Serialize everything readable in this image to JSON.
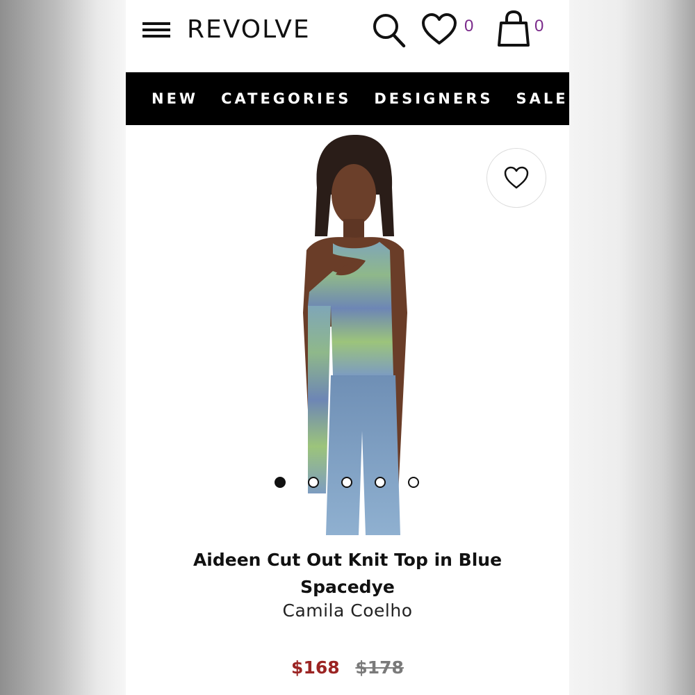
{
  "header": {
    "logo": "REVOLVE",
    "wishlist_count": "0",
    "bag_count": "0"
  },
  "nav": {
    "items": [
      "NEW",
      "CATEGORIES",
      "DESIGNERS",
      "SALE"
    ]
  },
  "product": {
    "title_line1": "Aideen Cut Out Knit Top in Blue",
    "title_line2": "Spacedye",
    "brand": "Camila Coelho",
    "sale_price": "$168",
    "original_price": "$178",
    "image_count": 5,
    "active_image": 1
  },
  "colors": {
    "sale_price": "#9b2423",
    "count_badge": "#7b2b8b",
    "nav_background": "#000000"
  },
  "icons": [
    "menu-icon",
    "search-icon",
    "heart-icon",
    "shopping-bag-icon",
    "favorite-heart-icon"
  ]
}
